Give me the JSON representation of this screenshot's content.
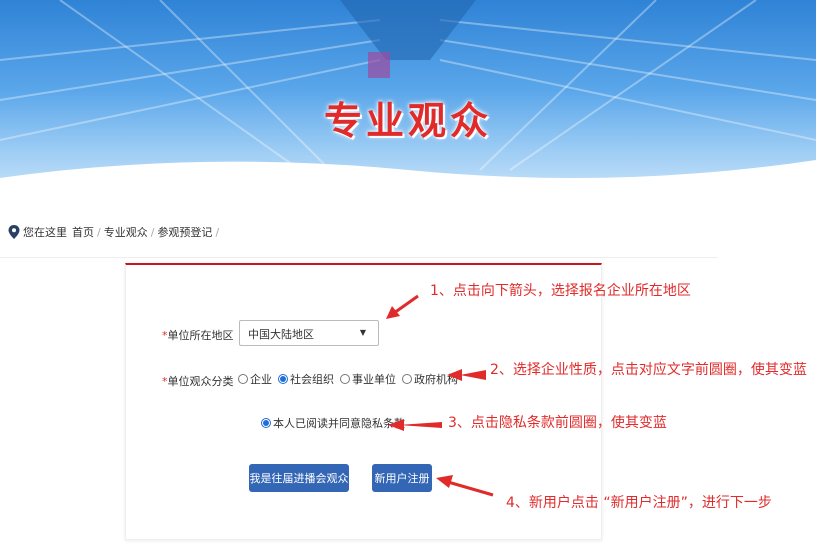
{
  "banner": {
    "title": "专业观众"
  },
  "breadcrumb": {
    "prefix": "您在这里",
    "items": [
      "首页",
      "专业观众",
      "参观预登记"
    ]
  },
  "form": {
    "region": {
      "label": "单位所在地区",
      "required_mark": "*",
      "selected": "中国大陆地区"
    },
    "category": {
      "label": "单位观众分类",
      "required_mark": "*",
      "options": [
        {
          "label": "企业",
          "checked": false
        },
        {
          "label": "社会组织",
          "checked": true
        },
        {
          "label": "事业单位",
          "checked": false
        },
        {
          "label": "政府机构",
          "checked": false
        }
      ]
    },
    "privacy": {
      "label": "本人已阅读并同意隐私条款",
      "checked": true
    },
    "buttons": {
      "returning": "我是往届进播会观众",
      "register": "新用户注册"
    }
  },
  "annotations": [
    "1、点击向下箭头，选择报名企业所在地区",
    "2、选择企业性质，点击对应文字前圆圈，使其变蓝",
    "3、点击隐私条款前圆圈，使其变蓝",
    "4、新用户点击 “新用户注册”，进行下一步"
  ],
  "colors": {
    "accent_red": "#e12b2b",
    "button_blue": "#3367b6",
    "radio_blue": "#1f6fd6",
    "card_top": "#c8161d"
  }
}
